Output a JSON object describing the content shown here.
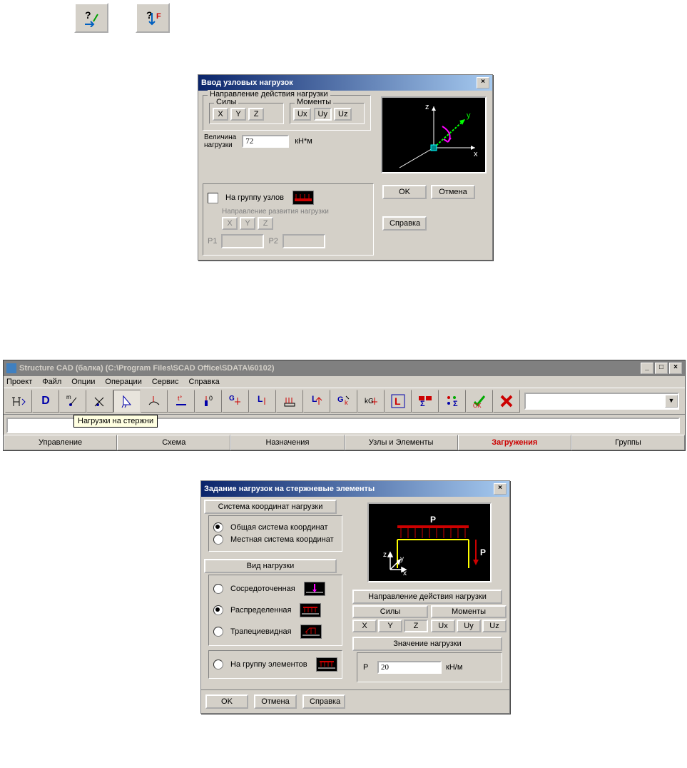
{
  "top_icons": [
    "help-arrow-icon",
    "help-f-icon"
  ],
  "dlg_nodal": {
    "title": "Ввод узловых нагрузок",
    "grp_direction": "Направление действия нагрузки",
    "grp_forces": "Силы",
    "grp_moments": "Моменты",
    "btn_X": "X",
    "btn_Y": "Y",
    "btn_Z": "Z",
    "btn_Ux": "Ux",
    "btn_Uy": "Uy",
    "btn_Uz": "Uz",
    "magnitude_label": "Величина\nнагрузки",
    "magnitude_value": "72",
    "magnitude_unit": "кН*м",
    "chk_group": "На группу узлов",
    "grp_dev": "Направление развития нагрузки",
    "p1": "P1",
    "p2": "P2",
    "btn_ok": "OK",
    "btn_cancel": "Отмена",
    "btn_help": "Справка"
  },
  "app": {
    "title": "Structure CAD (балка) (C:\\Program Files\\SCAD Office\\SDATA\\60102)",
    "menu": [
      "Проект",
      "Файл",
      "Опции",
      "Операции",
      "Сервис",
      "Справка"
    ],
    "tooltip": "Нагрузки на стержни",
    "tabs": [
      "Управление",
      "Схема",
      "Назначения",
      "Узлы и Элементы",
      "Загружения",
      "Группы"
    ],
    "active_tab": 4
  },
  "dlg_bar": {
    "title": "Задание нагрузок на стержневые элементы",
    "grp_coordsys": "Система координат нагрузки",
    "opt_global": "Общая система координат",
    "opt_local": "Местная  система координат",
    "grp_loadtype": "Вид нагрузки",
    "opt_conc": "Сосредоточенная",
    "opt_dist": "Распределенная",
    "opt_trap": "Трапециевидная",
    "opt_group": "На группу элементов",
    "grp_direction": "Направление действия нагрузки",
    "subgrp_forces": "Силы",
    "subgrp_moments": "Моменты",
    "btn_X": "X",
    "btn_Y": "Y",
    "btn_Z": "Z",
    "btn_Ux": "Ux",
    "btn_Uy": "Uy",
    "btn_Uz": "Uz",
    "grp_value": "Значение нагрузки",
    "p_label": "P",
    "p_value": "20",
    "p_unit": "кН/м",
    "btn_ok": "OK",
    "btn_cancel": "Отмена",
    "btn_help": "Справка",
    "preview_P": "P"
  }
}
